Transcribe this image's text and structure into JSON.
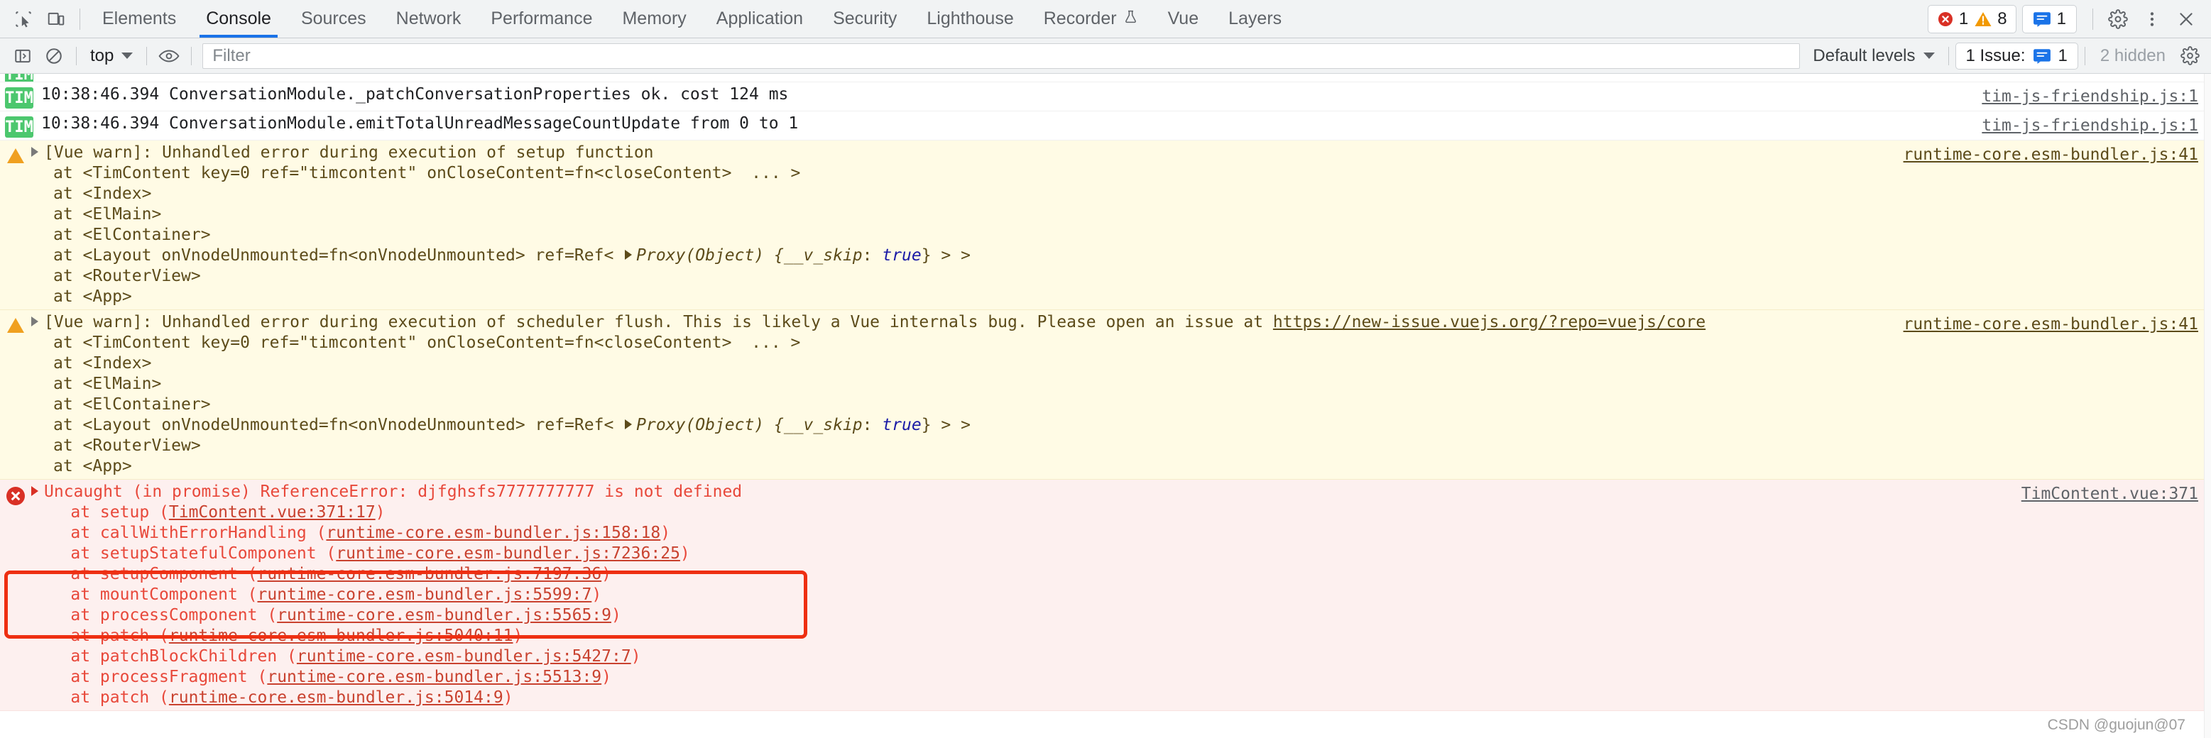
{
  "tabbar": {
    "inspect_icon": "inspect-element-icon",
    "device_icon": "device-toolbar-icon",
    "tabs": [
      {
        "label": "Elements",
        "active": false
      },
      {
        "label": "Console",
        "active": true
      },
      {
        "label": "Sources",
        "active": false
      },
      {
        "label": "Network",
        "active": false
      },
      {
        "label": "Performance",
        "active": false
      },
      {
        "label": "Memory",
        "active": false
      },
      {
        "label": "Application",
        "active": false
      },
      {
        "label": "Security",
        "active": false
      },
      {
        "label": "Lighthouse",
        "active": false
      },
      {
        "label": "Recorder",
        "active": false,
        "icon": "flask-icon"
      },
      {
        "label": "Vue",
        "active": false
      },
      {
        "label": "Layers",
        "active": false
      }
    ],
    "error_count": "1",
    "warning_count": "8",
    "message_count": "1",
    "settings_icon": "gear-icon",
    "more_icon": "kebab-menu-icon",
    "close_icon": "close-icon"
  },
  "consolebar": {
    "sidebar_icon": "show-console-sidebar-icon",
    "clear_icon": "clear-console-icon",
    "context": "top",
    "eye_icon": "create-live-expression-icon",
    "filter_placeholder": "Filter",
    "filter_value": "",
    "levels_label": "Default levels",
    "issues_label": "1 Issue:",
    "issues_count": "1",
    "hidden_label": "2 hidden",
    "console_settings_icon": "gear-icon"
  },
  "messages": [
    {
      "id": "row-clipped",
      "type": "tim",
      "badge": "TIM",
      "clipped": true,
      "text": "",
      "link": ""
    },
    {
      "id": "row-tim-1",
      "type": "tim",
      "badge": "TIM",
      "text": "10:38:46.394 ConversationModule._patchConversationProperties ok. cost 124 ms",
      "link": "tim-js-friendship.js:1"
    },
    {
      "id": "row-tim-2",
      "type": "tim",
      "badge": "TIM",
      "text": "10:38:46.394 ConversationModule.emitTotalUnreadMessageCountUpdate from 0 to 1",
      "link": "tim-js-friendship.js:1"
    },
    {
      "id": "row-warn-1",
      "type": "warn",
      "headline": "[Vue warn]: Unhandled error during execution of setup function",
      "stack": [
        "at <TimContent key=0 ref=\"timcontent\" onCloseContent=fn<closeContent>  ... >",
        "at <Index>",
        "at <ElMain>",
        "at <ElContainer>",
        "at <RouterView>",
        "at <App>"
      ],
      "proxy_line": {
        "prefix": "at <Layout onVnodeUnmounted=fn<onVnodeUnmounted> ref=Ref< ",
        "proxy": "Proxy(Object)",
        "brace_open": " {",
        "key": "__v_skip",
        "colon": ": ",
        "value": "true",
        "suffix": "} > >"
      },
      "link": "runtime-core.esm-bundler.js:41"
    },
    {
      "id": "row-warn-2",
      "type": "warn",
      "headline_prefix": "[Vue warn]: Unhandled error during execution of scheduler flush. This is likely a Vue internals bug. Please open an issue at ",
      "headline_url": "https://new-issue.vuejs.org/?repo=vuejs/core",
      "stack": [
        "at <TimContent key=0 ref=\"timcontent\" onCloseContent=fn<closeContent>  ... >",
        "at <Index>",
        "at <ElMain>",
        "at <ElContainer>",
        "at <RouterView>",
        "at <App>"
      ],
      "proxy_line": {
        "prefix": "at <Layout onVnodeUnmounted=fn<onVnodeUnmounted> ref=Ref< ",
        "proxy": "Proxy(Object)",
        "brace_open": " {",
        "key": "__v_skip",
        "colon": ": ",
        "value": "true",
        "suffix": "} > >"
      },
      "link": "runtime-core.esm-bundler.js:41"
    },
    {
      "id": "row-error-1",
      "type": "error",
      "headline": "Uncaught (in promise) ReferenceError: djfghsfs7777777777 is not defined",
      "frames": [
        {
          "fn": "    at setup (",
          "src": "TimContent.vue:371:17",
          "close": ")"
        },
        {
          "fn": "    at callWithErrorHandling (",
          "src": "runtime-core.esm-bundler.js:158:18",
          "close": ")"
        },
        {
          "fn": "    at setupStatefulComponent (",
          "src": "runtime-core.esm-bundler.js:7236:25",
          "close": ")"
        },
        {
          "fn": "    at setupComponent (",
          "src": "runtime-core.esm-bundler.js:7197:36",
          "close": ")"
        },
        {
          "fn": "    at mountComponent (",
          "src": "runtime-core.esm-bundler.js:5599:7",
          "close": ")"
        },
        {
          "fn": "    at processComponent (",
          "src": "runtime-core.esm-bundler.js:5565:9",
          "close": ")"
        },
        {
          "fn": "    at patch (",
          "src": "runtime-core.esm-bundler.js:5040:11",
          "close": ")"
        },
        {
          "fn": "    at patchBlockChildren (",
          "src": "runtime-core.esm-bundler.js:5427:7",
          "close": ")"
        },
        {
          "fn": "    at processFragment (",
          "src": "runtime-core.esm-bundler.js:5513:9",
          "close": ")"
        },
        {
          "fn": "    at patch (",
          "src": "runtime-core.esm-bundler.js:5014:9",
          "close": ")"
        }
      ],
      "link": "TimContent.vue:371"
    }
  ],
  "annotation": {
    "color": "#ee2f12"
  },
  "watermark": "CSDN @guojun@07"
}
